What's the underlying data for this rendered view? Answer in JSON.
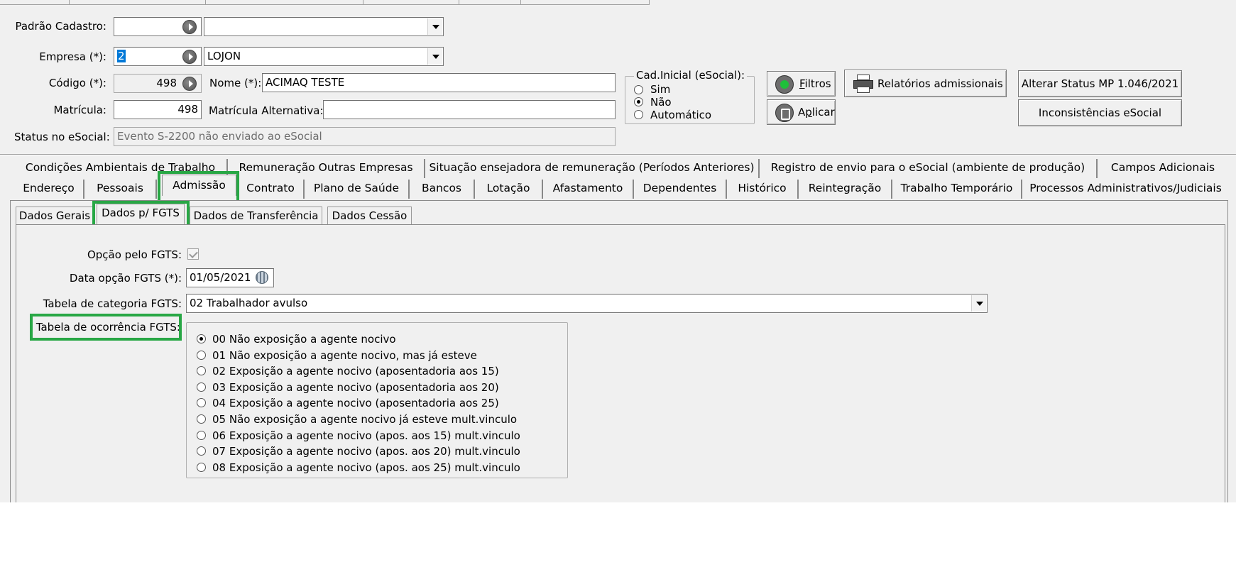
{
  "header": {
    "padrao_cadastro": {
      "label": "Padrão Cadastro:",
      "code": "",
      "value": ""
    },
    "empresa": {
      "label": "Empresa (*):",
      "code": "2",
      "value": "LOJON"
    },
    "codigo": {
      "label": "Código (*):",
      "value": "498"
    },
    "nome": {
      "label": "Nome (*):",
      "value": "ACIMAQ TESTE"
    },
    "matricula": {
      "label": "Matrícula:",
      "value": "498"
    },
    "matricula_alt": {
      "label": "Matrícula Alternativa:",
      "value": ""
    },
    "status_esocial": {
      "label": "Status no eSocial:",
      "value": "Evento S-2200 não enviado ao eSocial"
    }
  },
  "cad_inicial": {
    "title": "Cad.Inicial (eSocial):",
    "options": [
      "Sim",
      "Não",
      "Automático"
    ],
    "selected": "Não"
  },
  "buttons": {
    "filtros": "Filtros",
    "aplicar": "Aplicar",
    "relatorios": "Relatórios admissionais",
    "alterar_status": "Alterar Status MP 1.046/2021",
    "inconsistencias": "Inconsistências eSocial"
  },
  "tabs_row1": [
    "Condições Ambientais de Trabalho",
    "Remuneração Outras Empresas",
    "Situação ensejadora de remuneração (Períodos Anteriores)",
    "Registro de envio para o eSocial (ambiente de produção)",
    "Campos Adicionais"
  ],
  "tabs_row2": [
    "Endereço",
    "Pessoais",
    "Admissão",
    "Contrato",
    "Plano de Saúde",
    "Bancos",
    "Lotação",
    "Afastamento",
    "Dependentes",
    "Histórico",
    "Reintegração",
    "Trabalho Temporário",
    "Processos Administrativos/Judiciais"
  ],
  "active_tab": "Admissão",
  "subtabs": [
    "Dados Gerais",
    "Dados p/ FGTS",
    "Dados de Transferência",
    "Dados Cessão"
  ],
  "active_subtab": "Dados p/ FGTS",
  "fgts": {
    "opcao_label": "Opção pelo FGTS:",
    "opcao_checked": true,
    "data_label": "Data opção FGTS (*):",
    "data_value": "01/05/2021",
    "categoria_label": "Tabela de categoria FGTS:",
    "categoria_value": "02 Trabalhador avulso",
    "ocorrencia_label": "Tabela de ocorrência FGTS:",
    "ocorrencias": [
      "00 Não exposição a agente nocivo",
      "01 Não exposição a agente nocivo, mas já esteve",
      "02 Exposição a agente nocivo (aposentadoria aos 15)",
      "03 Exposição a agente nocivo (aposentadoria aos 20)",
      "04 Exposição a agente nocivo (aposentadoria aos 25)",
      "05 Não exposição a agente nocivo já esteve mult.vinculo",
      "06 Exposição a agente nocivo (apos. aos 15) mult.vinculo",
      "07 Exposição a agente nocivo (apos. aos 20) mult.vinculo",
      "08 Exposição a agente nocivo (apos. aos 25) mult.vinculo"
    ],
    "ocorrencia_selected": 0
  },
  "colors": {
    "highlight": "#28a745",
    "window_bg": "#f0f0f0",
    "selection": "#0078d7"
  }
}
